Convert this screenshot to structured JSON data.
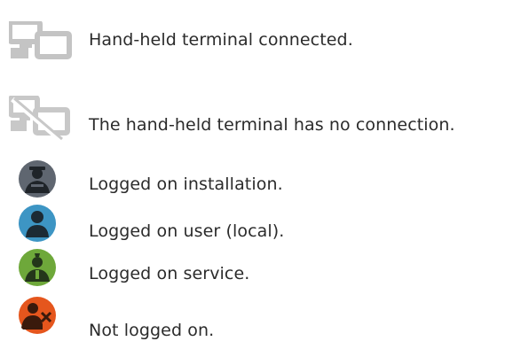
{
  "legend": [
    {
      "icon": "terminal-connected-icon",
      "label": "Hand-held terminal connected."
    },
    {
      "icon": "terminal-disconnected-icon",
      "label": "The hand-held terminal has no connection."
    },
    {
      "icon": "user-installation-icon",
      "label": "Logged on installation.",
      "color": "#5f6670"
    },
    {
      "icon": "user-local-icon",
      "label": "Logged on user (local).",
      "color": "#3d95c4"
    },
    {
      "icon": "user-service-icon",
      "label": "Logged on service.",
      "color": "#6ea83a"
    },
    {
      "icon": "user-not-logged-icon",
      "label": "Not logged on.",
      "color": "#e5561d"
    }
  ]
}
